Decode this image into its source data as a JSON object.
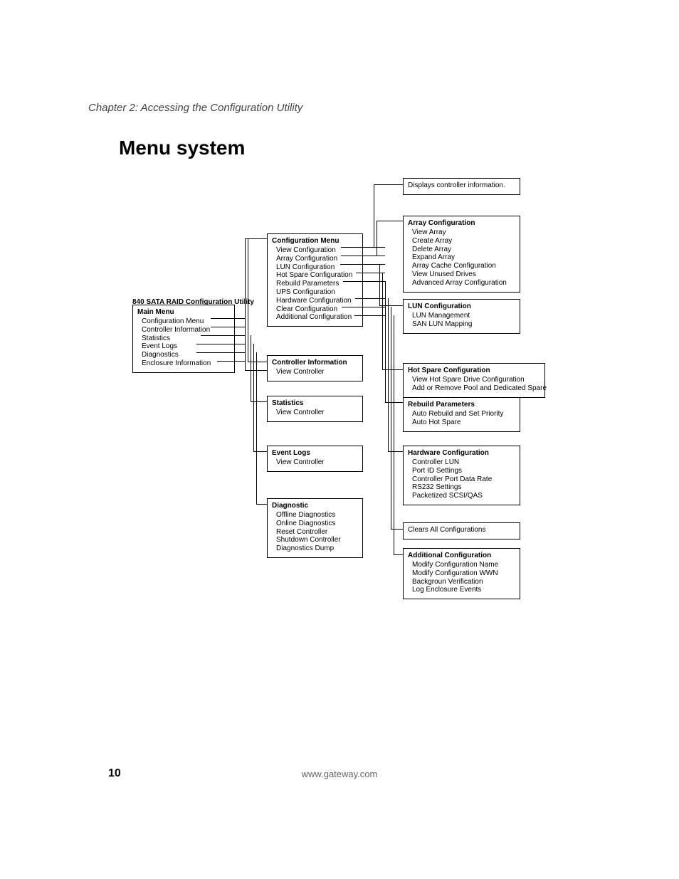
{
  "chapter": "Chapter 2: Accessing the Configuration Utility",
  "title": "Menu system",
  "footer_url": "www.gateway.com",
  "page_number": "10",
  "utility_label": "840 SATA RAID Configuration Utility",
  "main_menu": {
    "title": "Main Menu",
    "items": [
      "Configuration Menu",
      "Controller Information",
      "Statistics",
      "Event Logs",
      "Diagnostics",
      "Enclosure Information"
    ]
  },
  "config_menu": {
    "title": "Configuration Menu",
    "items": [
      "View Configuration",
      "Array Configuration",
      "LUN Configuration",
      "Hot Spare Configuration",
      "Rebuild Parameters",
      "UPS Configuration",
      "Hardware Configuration",
      "Clear Configuration",
      "Additional Configuration"
    ]
  },
  "controller_info": {
    "title": "Controller Information",
    "items": [
      "View Controller"
    ]
  },
  "statistics": {
    "title": "Statistics",
    "items": [
      "View Controller"
    ]
  },
  "event_logs": {
    "title": "Event Logs",
    "items": [
      "View Controller"
    ]
  },
  "diagnostic": {
    "title": "Diagnostic",
    "items": [
      "Offline Diagnostics",
      "Online Diagnostics",
      "Reset Controller",
      "Shutdown Controller",
      "Diagnostics Dump"
    ]
  },
  "displays_controller": "Displays controller information.",
  "array_config": {
    "title": "Array Configuration",
    "items": [
      "View Array",
      "Create Array",
      "Delete Array",
      "Expand Array",
      "Array Cache Configuration",
      "View Unused Drives",
      "Advanced Array Configuration"
    ]
  },
  "lun_config": {
    "title": "LUN Configuration",
    "items": [
      "LUN Management",
      "SAN LUN Mapping"
    ]
  },
  "hot_spare": {
    "title": "Hot Spare Configuration",
    "items": [
      "View Hot Spare Drive Configuration",
      "Add or Remove Pool and Dedicated Spare"
    ]
  },
  "rebuild": {
    "title": "Rebuild Parameters",
    "items": [
      "Auto Rebuild and Set Priority",
      "Auto Hot Spare"
    ]
  },
  "hardware": {
    "title": "Hardware Configuration",
    "items": [
      "Controller LUN",
      "Port ID Settings",
      "Controller Port Data Rate",
      "RS232 Settings",
      "Packetized SCSI/QAS"
    ]
  },
  "clears_all": "Clears All Configurations",
  "additional": {
    "title": "Additional Configuration",
    "items": [
      "Modify Configuration Name",
      "Modify Configuration WWN",
      "Backgroun Verification",
      "Log Enclosure Events"
    ]
  }
}
